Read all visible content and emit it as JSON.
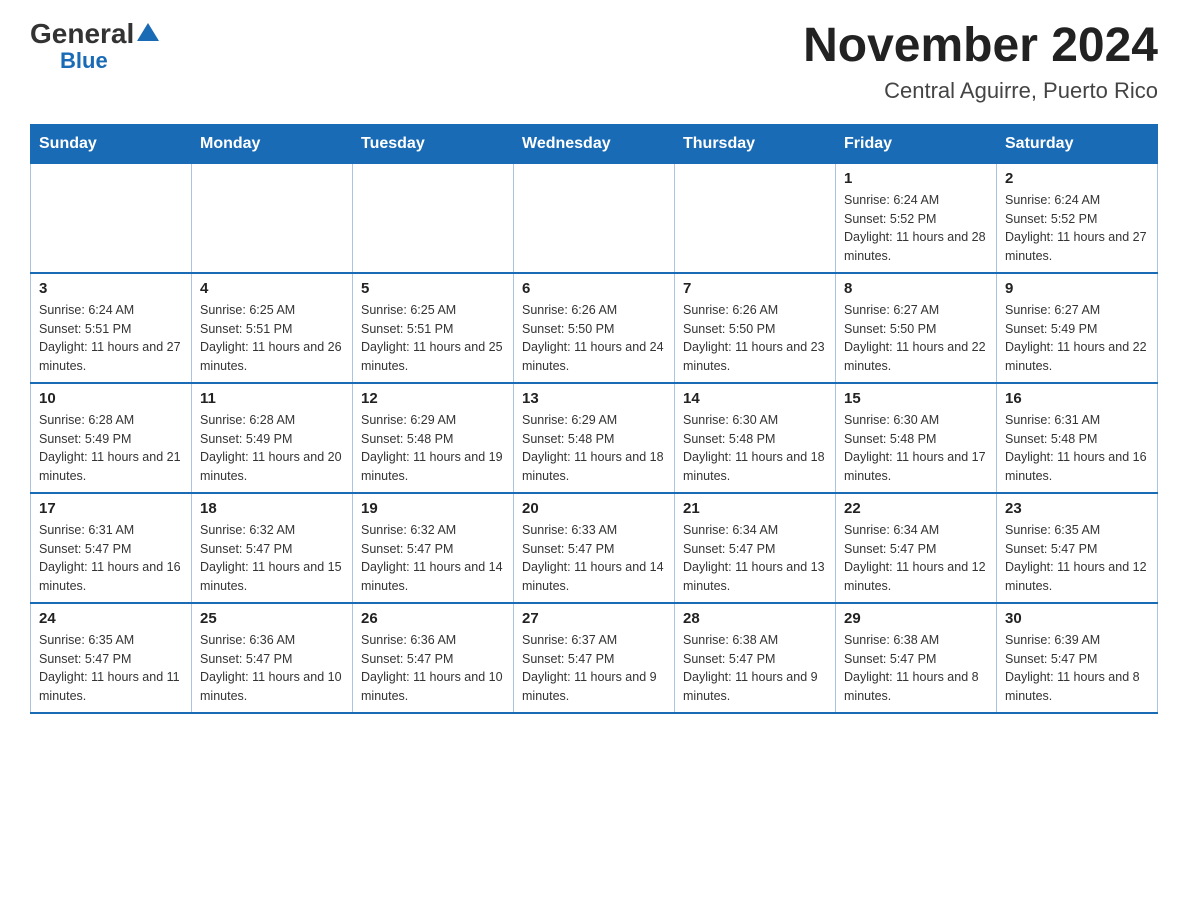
{
  "header": {
    "logo_general": "General",
    "logo_blue": "Blue",
    "title": "November 2024",
    "subtitle": "Central Aguirre, Puerto Rico"
  },
  "weekdays": [
    "Sunday",
    "Monday",
    "Tuesday",
    "Wednesday",
    "Thursday",
    "Friday",
    "Saturday"
  ],
  "weeks": [
    [
      {
        "day": "",
        "info": ""
      },
      {
        "day": "",
        "info": ""
      },
      {
        "day": "",
        "info": ""
      },
      {
        "day": "",
        "info": ""
      },
      {
        "day": "",
        "info": ""
      },
      {
        "day": "1",
        "info": "Sunrise: 6:24 AM\nSunset: 5:52 PM\nDaylight: 11 hours and 28 minutes."
      },
      {
        "day": "2",
        "info": "Sunrise: 6:24 AM\nSunset: 5:52 PM\nDaylight: 11 hours and 27 minutes."
      }
    ],
    [
      {
        "day": "3",
        "info": "Sunrise: 6:24 AM\nSunset: 5:51 PM\nDaylight: 11 hours and 27 minutes."
      },
      {
        "day": "4",
        "info": "Sunrise: 6:25 AM\nSunset: 5:51 PM\nDaylight: 11 hours and 26 minutes."
      },
      {
        "day": "5",
        "info": "Sunrise: 6:25 AM\nSunset: 5:51 PM\nDaylight: 11 hours and 25 minutes."
      },
      {
        "day": "6",
        "info": "Sunrise: 6:26 AM\nSunset: 5:50 PM\nDaylight: 11 hours and 24 minutes."
      },
      {
        "day": "7",
        "info": "Sunrise: 6:26 AM\nSunset: 5:50 PM\nDaylight: 11 hours and 23 minutes."
      },
      {
        "day": "8",
        "info": "Sunrise: 6:27 AM\nSunset: 5:50 PM\nDaylight: 11 hours and 22 minutes."
      },
      {
        "day": "9",
        "info": "Sunrise: 6:27 AM\nSunset: 5:49 PM\nDaylight: 11 hours and 22 minutes."
      }
    ],
    [
      {
        "day": "10",
        "info": "Sunrise: 6:28 AM\nSunset: 5:49 PM\nDaylight: 11 hours and 21 minutes."
      },
      {
        "day": "11",
        "info": "Sunrise: 6:28 AM\nSunset: 5:49 PM\nDaylight: 11 hours and 20 minutes."
      },
      {
        "day": "12",
        "info": "Sunrise: 6:29 AM\nSunset: 5:48 PM\nDaylight: 11 hours and 19 minutes."
      },
      {
        "day": "13",
        "info": "Sunrise: 6:29 AM\nSunset: 5:48 PM\nDaylight: 11 hours and 18 minutes."
      },
      {
        "day": "14",
        "info": "Sunrise: 6:30 AM\nSunset: 5:48 PM\nDaylight: 11 hours and 18 minutes."
      },
      {
        "day": "15",
        "info": "Sunrise: 6:30 AM\nSunset: 5:48 PM\nDaylight: 11 hours and 17 minutes."
      },
      {
        "day": "16",
        "info": "Sunrise: 6:31 AM\nSunset: 5:48 PM\nDaylight: 11 hours and 16 minutes."
      }
    ],
    [
      {
        "day": "17",
        "info": "Sunrise: 6:31 AM\nSunset: 5:47 PM\nDaylight: 11 hours and 16 minutes."
      },
      {
        "day": "18",
        "info": "Sunrise: 6:32 AM\nSunset: 5:47 PM\nDaylight: 11 hours and 15 minutes."
      },
      {
        "day": "19",
        "info": "Sunrise: 6:32 AM\nSunset: 5:47 PM\nDaylight: 11 hours and 14 minutes."
      },
      {
        "day": "20",
        "info": "Sunrise: 6:33 AM\nSunset: 5:47 PM\nDaylight: 11 hours and 14 minutes."
      },
      {
        "day": "21",
        "info": "Sunrise: 6:34 AM\nSunset: 5:47 PM\nDaylight: 11 hours and 13 minutes."
      },
      {
        "day": "22",
        "info": "Sunrise: 6:34 AM\nSunset: 5:47 PM\nDaylight: 11 hours and 12 minutes."
      },
      {
        "day": "23",
        "info": "Sunrise: 6:35 AM\nSunset: 5:47 PM\nDaylight: 11 hours and 12 minutes."
      }
    ],
    [
      {
        "day": "24",
        "info": "Sunrise: 6:35 AM\nSunset: 5:47 PM\nDaylight: 11 hours and 11 minutes."
      },
      {
        "day": "25",
        "info": "Sunrise: 6:36 AM\nSunset: 5:47 PM\nDaylight: 11 hours and 10 minutes."
      },
      {
        "day": "26",
        "info": "Sunrise: 6:36 AM\nSunset: 5:47 PM\nDaylight: 11 hours and 10 minutes."
      },
      {
        "day": "27",
        "info": "Sunrise: 6:37 AM\nSunset: 5:47 PM\nDaylight: 11 hours and 9 minutes."
      },
      {
        "day": "28",
        "info": "Sunrise: 6:38 AM\nSunset: 5:47 PM\nDaylight: 11 hours and 9 minutes."
      },
      {
        "day": "29",
        "info": "Sunrise: 6:38 AM\nSunset: 5:47 PM\nDaylight: 11 hours and 8 minutes."
      },
      {
        "day": "30",
        "info": "Sunrise: 6:39 AM\nSunset: 5:47 PM\nDaylight: 11 hours and 8 minutes."
      }
    ]
  ]
}
